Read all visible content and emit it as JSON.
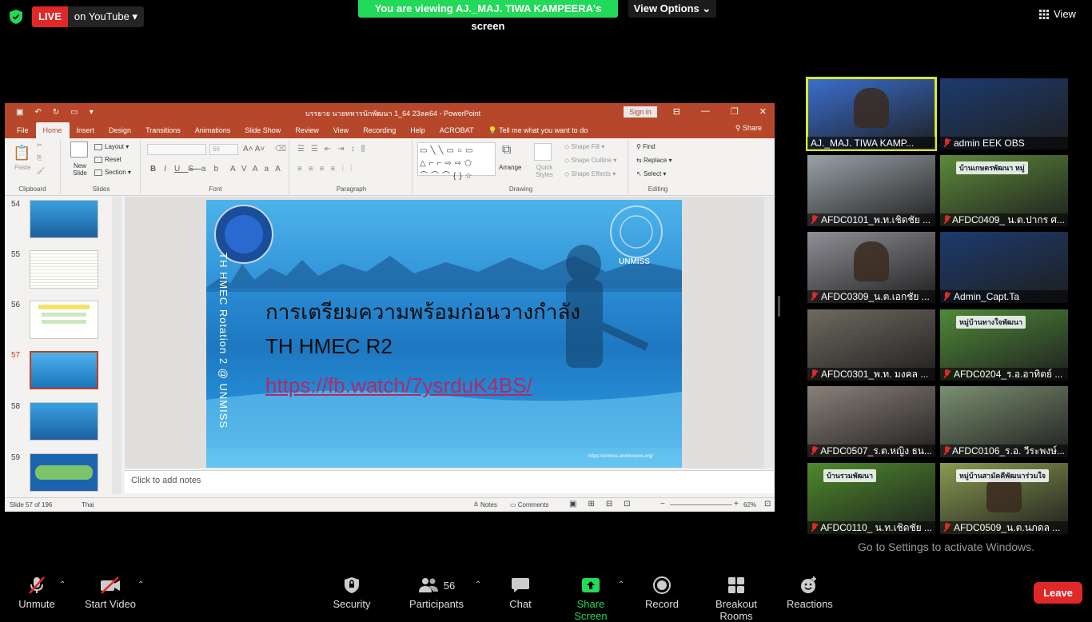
{
  "topbar": {
    "live_badge": "LIVE",
    "live_dest": "on YouTube",
    "viewing_banner": "You are viewing AJ._MAJ. TIWA KAMPEERA's screen",
    "view_options": "View Options",
    "view_button": "View"
  },
  "ppt": {
    "title": "บรรยาย นายทหารนักพัฒนา 1_64 23ลค64 - PowerPoint",
    "sign_in": "Sign in",
    "tabs": [
      "File",
      "Home",
      "Insert",
      "Design",
      "Transitions",
      "Animations",
      "Slide Show",
      "Review",
      "View",
      "Recording",
      "Help",
      "ACROBAT"
    ],
    "tell_me": "Tell me what you want to do",
    "share": "Share",
    "ribbon": {
      "clipboard": {
        "label": "Clipboard",
        "paste": "Paste"
      },
      "slides": {
        "label": "Slides",
        "new_slide": "New Slide",
        "layout": "Layout",
        "reset": "Reset",
        "section": "Section"
      },
      "font": {
        "label": "Font",
        "size": "66",
        "buttons": [
          "B",
          "I",
          "U",
          "S",
          "ab",
          "AV",
          "Aa",
          "A"
        ]
      },
      "paragraph": {
        "label": "Paragraph"
      },
      "drawing": {
        "label": "Drawing",
        "arrange": "Arrange",
        "quick_styles": "Quick Styles",
        "shape_fill": "Shape Fill",
        "shape_outline": "Shape Outline",
        "shape_effects": "Shape Effects"
      },
      "editing": {
        "label": "Editing",
        "find": "Find",
        "replace": "Replace",
        "select": "Select"
      }
    },
    "slide_numbers": [
      "54",
      "55",
      "56",
      "57",
      "58",
      "59"
    ],
    "selected_slide": "57",
    "slide": {
      "vertical_text": "TH HMEC Rotation 2 @ UNMISS",
      "unmiss": "UNMISS",
      "heading": "การเตรียมความพร้อมก่อนวางกำลัง",
      "subheading": "TH HMEC R2",
      "link": "https://fb.watch/7ysrduK4BS/",
      "footer_url": "https://unmiss.unmissions.org/"
    },
    "notes_placeholder": "Click to add notes",
    "status": {
      "slide_count": "Slide 57 of 196",
      "language": "Thai",
      "notes": "Notes",
      "comments": "Comments",
      "zoom": "62%"
    }
  },
  "gallery": [
    {
      "name": "AJ._MAJ. TIWA KAMP...",
      "muted": false,
      "active": true,
      "bg": "#3a6fd0"
    },
    {
      "name": "admin EEK OBS",
      "muted": true,
      "active": false,
      "bg": "#1d3b6e"
    },
    {
      "name": "AFDC0101_พ.ท.เชิดชัย ...",
      "muted": true,
      "active": false,
      "bg": "#9aa2a8"
    },
    {
      "name": "AFDC0409_ น.ต.ปากร ศ...",
      "muted": true,
      "active": false,
      "bg": "#5d8a3a"
    },
    {
      "name": "AFDC0309_น.ต.เอกชัย ...",
      "muted": true,
      "active": false,
      "bg": "#8f8f96"
    },
    {
      "name": "Admin_Capt.Ta",
      "muted": true,
      "active": false,
      "bg": "#1d3b6e"
    },
    {
      "name": "AFDC0301_พ.ท. มงคล ...",
      "muted": true,
      "active": false,
      "bg": "#6e6a60"
    },
    {
      "name": "AFDC0204_ร.อ.อาทิตย์ ...",
      "muted": true,
      "active": false,
      "bg": "#4f8a3a"
    },
    {
      "name": "AFDC0507_ร.ต.หญิง ธน...",
      "muted": true,
      "active": false,
      "bg": "#8a8078"
    },
    {
      "name": "AFDC0106_ร.อ. วีระพงษ์...",
      "muted": true,
      "active": false,
      "bg": "#7a8f70"
    },
    {
      "name": "AFDC0110_ น.ท.เชิดชัย ...",
      "muted": true,
      "active": false,
      "bg": "#4e8a2c"
    },
    {
      "name": "AFDC0509_น.ต.นภดล ...",
      "muted": true,
      "active": false,
      "bg": "#8a9a50"
    }
  ],
  "gallery_banners": {
    "village1": "บ้านเกษตรพัฒนา หมู่",
    "village2": "หมู่บ้านทางใจพัฒนา",
    "village3": "บ้านรวมพัฒนา",
    "village4": "หมู่บ้านสามัคคีพัฒนาร่วมใจ"
  },
  "activate_windows": "Go to Settings to activate Windows.",
  "toolbar": {
    "unmute": "Unmute",
    "start_video": "Start Video",
    "security": "Security",
    "participants": "Participants",
    "participants_count": "56",
    "chat": "Chat",
    "share_screen": "Share Screen",
    "record": "Record",
    "breakout": "Breakout Rooms",
    "reactions": "Reactions",
    "leave": "Leave"
  },
  "colors": {
    "ppt_accent": "#b7472a",
    "zoom_green": "#23d959",
    "leave_red": "#e02828",
    "active_speaker": "#d6e82c"
  }
}
